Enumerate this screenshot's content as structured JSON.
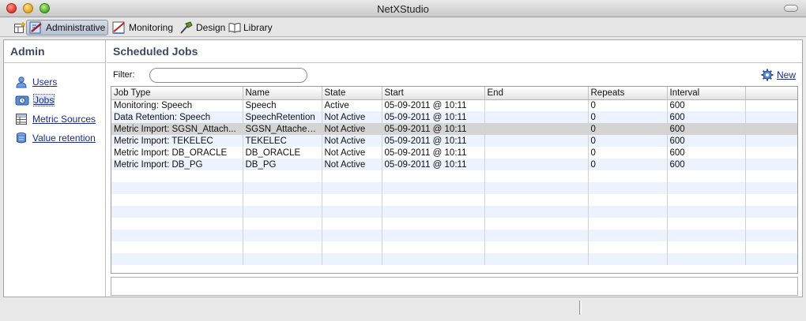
{
  "window": {
    "title": "NetXStudio"
  },
  "perspectives": [
    {
      "label": "Administrative",
      "active": true
    },
    {
      "label": "Monitoring",
      "active": false
    },
    {
      "label": "Design",
      "active": false
    },
    {
      "label": "Library",
      "active": false
    }
  ],
  "admin": {
    "title": "Admin",
    "items": [
      {
        "label": "Users"
      },
      {
        "label": "Jobs",
        "selected": true
      },
      {
        "label": "Metric Sources"
      },
      {
        "label": "Value retention"
      }
    ]
  },
  "jobs": {
    "title": "Scheduled Jobs",
    "filter_label": "Filter:",
    "filter_value": "",
    "new_label": "New",
    "columns": [
      "Job Type",
      "Name",
      "State",
      "Start",
      "End",
      "Repeats",
      "Interval",
      ""
    ],
    "rows": [
      [
        "Monitoring: Speech",
        "Speech",
        "Active",
        "05-09-2011 @ 10:11",
        "",
        "0",
        "600",
        ""
      ],
      [
        "Data Retention: Speech",
        "SpeechRetention",
        "Not Active",
        "05-09-2011 @ 10:11",
        "",
        "0",
        "600",
        ""
      ],
      [
        "Metric Import: SGSN_Attach...",
        "SGSN_Attached...",
        "Not Active",
        "05-09-2011 @ 10:11",
        "",
        "0",
        "600",
        ""
      ],
      [
        "Metric Import: TEKELEC",
        "TEKELEC",
        "Not Active",
        "05-09-2011 @ 10:11",
        "",
        "0",
        "600",
        ""
      ],
      [
        "Metric Import: DB_ORACLE",
        "DB_ORACLE",
        "Not Active",
        "05-09-2011 @ 10:11",
        "",
        "0",
        "600",
        ""
      ],
      [
        "Metric Import: DB_PG",
        "DB_PG",
        "Not Active",
        "05-09-2011 @ 10:11",
        "",
        "0",
        "600",
        ""
      ]
    ],
    "selected_row": 2
  },
  "colors": {
    "title_text": "#3b4a63",
    "link": "#1b2a8c",
    "stripe": "#edf3fe",
    "selected_row": "#d4d4d4"
  }
}
